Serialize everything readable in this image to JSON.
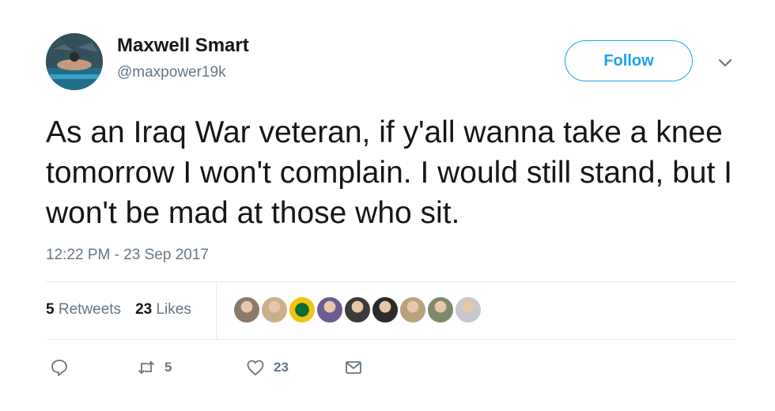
{
  "author": {
    "display_name": "Maxwell Smart",
    "screen_name": "@maxpower19k"
  },
  "follow_label": "Follow",
  "tweet": {
    "text": "As an Iraq War veteran, if y'all wanna take a knee tomorrow I won't complain. I would still stand, but I won't be mad at those who sit.",
    "timestamp": "12:22 PM - 23 Sep 2017"
  },
  "stats": {
    "retweets_count": "5",
    "retweets_label": "Retweets",
    "likes_count": "23",
    "likes_label": "Likes"
  },
  "liker_avatars": [
    {
      "color": "#8a7a6a"
    },
    {
      "color": "#c9b08a"
    },
    {
      "color": "#f1c40f"
    },
    {
      "color": "#6d5c8f"
    },
    {
      "color": "#3b3b3b"
    },
    {
      "color": "#2a2a2a"
    },
    {
      "color": "#b9a27c"
    },
    {
      "color": "#7f8a6c"
    },
    {
      "color": "#c7c9cc"
    }
  ],
  "actions": {
    "reply_icon": "reply-icon",
    "retweet_count": "5",
    "like_count": "23",
    "message_icon": "message-icon"
  },
  "colors": {
    "accent": "#1da1f2",
    "secondary_text": "#657786",
    "divider": "#e6ecf0"
  }
}
